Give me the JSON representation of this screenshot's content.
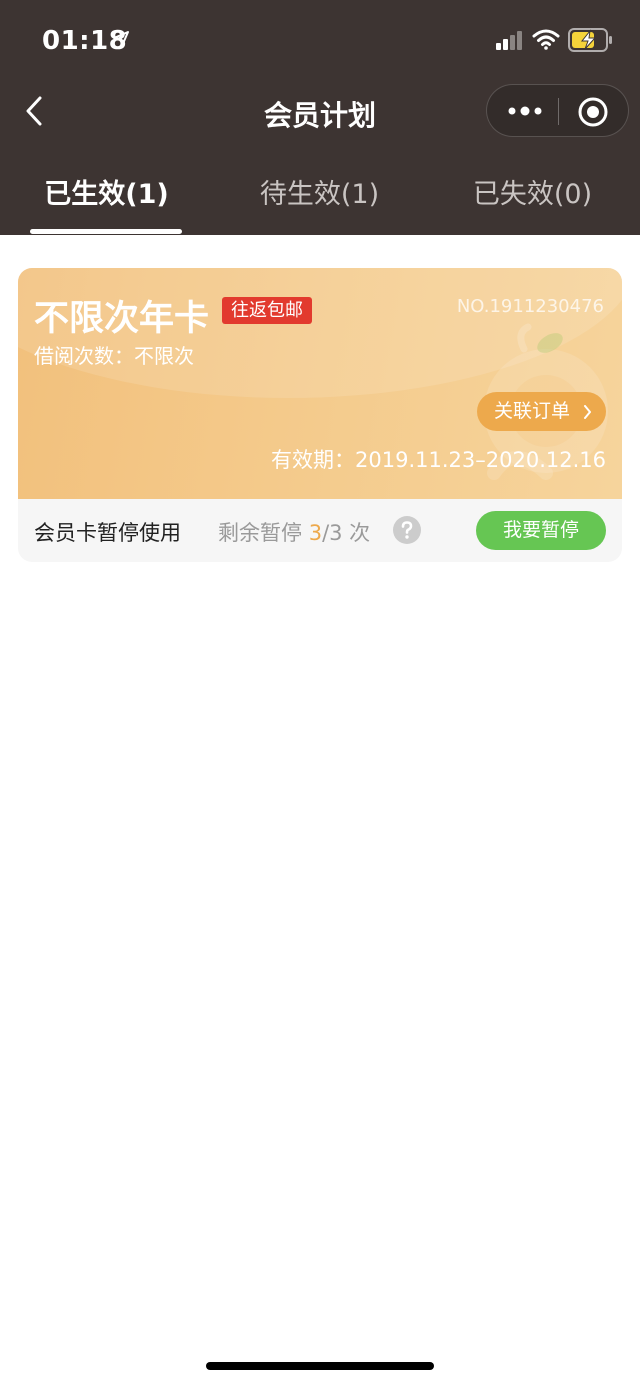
{
  "status_bar": {
    "time": "01:18",
    "icons": [
      "location-arrow-icon",
      "signal-icon",
      "wifi-icon",
      "battery-charging-icon"
    ]
  },
  "nav": {
    "title": "会员计划",
    "back_icon": "chevron-left-icon",
    "capsule_icons": [
      "more-dots-icon",
      "close-target-icon"
    ]
  },
  "tabs": [
    {
      "label": "已生效(1)",
      "active": true
    },
    {
      "label": "待生效(1)",
      "active": false
    },
    {
      "label": "已失效(0)",
      "active": false
    }
  ],
  "card": {
    "name": "不限次年卡",
    "badge": "往返包邮",
    "number": "NO.1911230476",
    "borrow_label": "借阅次数：不限次",
    "order_button": "关联订单",
    "validity": "有效期：2019.11.23–2020.12.16",
    "pause_title": "会员卡暂停使用",
    "pause_remaining_prefix": "剩余暂停 ",
    "pause_remaining_used": "3",
    "pause_remaining_suffix": "/3 次",
    "pause_button": "我要暂停"
  },
  "colors": {
    "header_bg": "#3d3432",
    "card_gold": "#f4ca8b",
    "badge_red": "#e23a2e",
    "order_orange": "#eda94c",
    "pause_green": "#66c653"
  }
}
